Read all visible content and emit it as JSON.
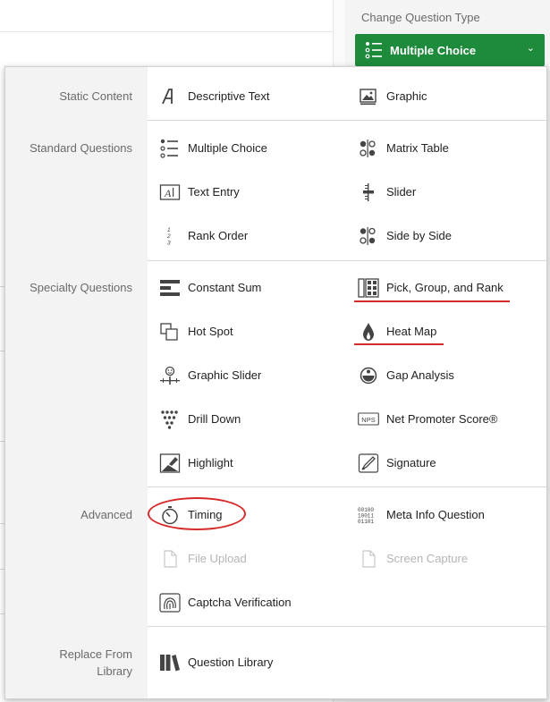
{
  "right_panel": {
    "label": "Change Question Type",
    "button_label": "Multiple Choice",
    "button_color": "#1d8a3c"
  },
  "menu": {
    "categories": {
      "static": "Static Content",
      "standard": "Standard Questions",
      "specialty": "Specialty Questions",
      "advanced": "Advanced",
      "replace_line1": "Replace From",
      "replace_line2": "Library"
    },
    "items": {
      "descriptive_text": "Descriptive Text",
      "graphic": "Graphic",
      "multiple_choice": "Multiple Choice",
      "matrix_table": "Matrix Table",
      "text_entry": "Text Entry",
      "slider": "Slider",
      "rank_order": "Rank Order",
      "side_by_side": "Side by Side",
      "constant_sum": "Constant Sum",
      "pick_group_rank": "Pick, Group, and Rank",
      "hot_spot": "Hot Spot",
      "heat_map": "Heat Map",
      "graphic_slider": "Graphic Slider",
      "gap_analysis": "Gap Analysis",
      "drill_down": "Drill Down",
      "net_promoter": "Net Promoter Score®",
      "highlight": "Highlight",
      "signature": "Signature",
      "timing": "Timing",
      "meta_info": "Meta Info Question",
      "file_upload": "File Upload",
      "screen_capture": "Screen Capture",
      "captcha": "Captcha Verification",
      "question_library": "Question Library"
    },
    "icon_text": {
      "text_entry_glyph": "A",
      "rank_1": "1",
      "rank_2": "2",
      "rank_3": "3",
      "nps_badge": "NPS",
      "meta_row1": "00100",
      "meta_row2": "10011",
      "meta_row3": "01101"
    },
    "disabled_items": [
      "File Upload",
      "Screen Capture"
    ],
    "annotation_color": "#d62b2b"
  }
}
